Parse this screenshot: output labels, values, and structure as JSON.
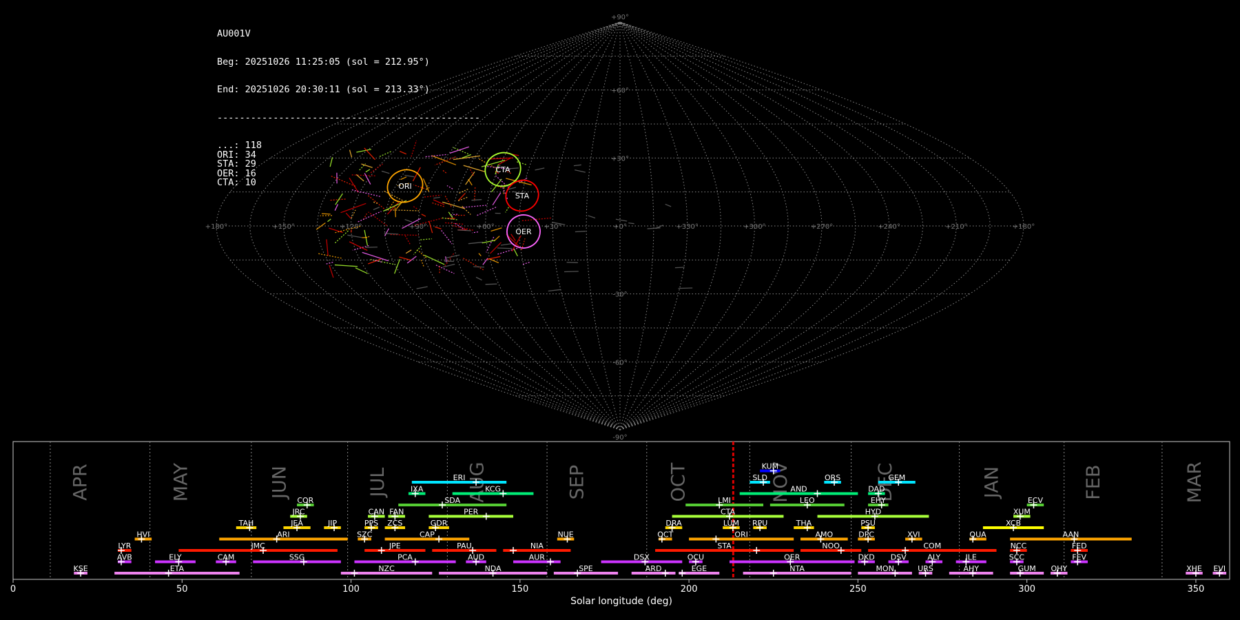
{
  "info": {
    "station": "AU001V",
    "begin": "Beg: 20251026 11:25:05 (sol = 212.95°)",
    "end": "End: 20251026 20:30:11 (sol = 213.33°)",
    "separator": "-----------------------------------------------",
    "counts": [
      {
        "label": "...",
        "value": "118"
      },
      {
        "label": "ORI",
        "value": "34"
      },
      {
        "label": "STA",
        "value": "29"
      },
      {
        "label": "OER",
        "value": "16"
      },
      {
        "label": "CTA",
        "value": "10"
      }
    ]
  },
  "sky_map": {
    "projection": "sinusoidal",
    "lat_labels": [
      "+90°",
      "+60°",
      "+30°",
      "-30°",
      "-60°",
      "-90°"
    ],
    "lon_labels": [
      "+180°",
      "+150°",
      "+120°",
      "+90°",
      "+60°",
      "+30°",
      "+0°",
      "+330°",
      "+300°",
      "+270°",
      "+240°",
      "+210°",
      "+180°"
    ],
    "radiants": [
      {
        "code": "CTA",
        "lon": 35,
        "lat": 25,
        "color": "#adff2f"
      },
      {
        "code": "ORI",
        "lon": 95,
        "lat": 0,
        "color": "#ffa500"
      },
      {
        "code": "STA",
        "lon": 45,
        "lat": 15,
        "color": "#ff0000"
      },
      {
        "code": "OER",
        "lon": 45,
        "lat": -10,
        "color": "#ff66ff"
      }
    ]
  },
  "chart_data": {
    "type": "timeline",
    "xlabel": "Solar longitude (deg)",
    "xlim": [
      0,
      360
    ],
    "xticks": [
      0,
      50,
      100,
      150,
      200,
      250,
      300,
      350
    ],
    "current_sol": 213.1,
    "months": [
      {
        "name": "APR",
        "start": 11
      },
      {
        "name": "MAY",
        "start": 40.5
      },
      {
        "name": "JUN",
        "start": 70.5
      },
      {
        "name": "JUL",
        "start": 99
      },
      {
        "name": "AUG",
        "start": 128.5
      },
      {
        "name": "SEP",
        "start": 158
      },
      {
        "name": "OCT",
        "start": 187.5
      },
      {
        "name": "NOV",
        "start": 218
      },
      {
        "name": "DEC",
        "start": 248
      },
      {
        "name": "JAN",
        "start": 280
      },
      {
        "name": "FEB",
        "start": 311
      },
      {
        "name": "MAR",
        "start": 340
      }
    ],
    "showers": [
      {
        "code": "KUM",
        "start": 221,
        "end": 227,
        "peak": 225,
        "row": 9,
        "color": "#0000ff"
      },
      {
        "code": "ERI",
        "start": 118,
        "end": 146,
        "peak": 137,
        "row": 8,
        "color": "#00e5ff"
      },
      {
        "code": "SLD",
        "start": 218,
        "end": 224,
        "peak": 222,
        "row": 8,
        "color": "#00e5ff"
      },
      {
        "code": "ORS",
        "start": 240,
        "end": 245,
        "peak": 243,
        "row": 8,
        "color": "#00e5ff"
      },
      {
        "code": "GEM",
        "start": 256,
        "end": 267,
        "peak": 262,
        "row": 8,
        "color": "#00e5ff"
      },
      {
        "code": "IXA",
        "start": 117,
        "end": 122,
        "peak": 119,
        "row": 7,
        "color": "#00ee77"
      },
      {
        "code": "KCG",
        "start": 130,
        "end": 154,
        "peak": 145,
        "row": 7,
        "color": "#00ee77"
      },
      {
        "code": "AND",
        "start": 215,
        "end": 250,
        "peak": 238,
        "row": 7,
        "color": "#00ee77"
      },
      {
        "code": "DAD",
        "start": 253,
        "end": 258,
        "peak": 256,
        "row": 7,
        "color": "#00ee77"
      },
      {
        "code": "COR",
        "start": 84,
        "end": 89,
        "peak": 87,
        "row": 6,
        "color": "#55cc33"
      },
      {
        "code": "SDA",
        "start": 114,
        "end": 146,
        "peak": 127,
        "row": 6,
        "color": "#55cc33"
      },
      {
        "code": "LMI",
        "start": 199,
        "end": 222,
        "peak": 209,
        "row": 6,
        "color": "#55cc33"
      },
      {
        "code": "LEO",
        "start": 224,
        "end": 246,
        "peak": 235,
        "row": 6,
        "color": "#55cc33"
      },
      {
        "code": "EHY",
        "start": 253,
        "end": 259,
        "peak": 257,
        "row": 6,
        "color": "#55cc33"
      },
      {
        "code": "ECV",
        "start": 300,
        "end": 305,
        "peak": 302,
        "row": 6,
        "color": "#55cc33"
      },
      {
        "code": "JRC",
        "start": 82,
        "end": 87,
        "peak": 85,
        "row": 5,
        "color": "#a8ff3a"
      },
      {
        "code": "CAN",
        "start": 105,
        "end": 110,
        "peak": 107,
        "row": 5,
        "color": "#a8ff3a"
      },
      {
        "code": "FAN",
        "start": 111,
        "end": 116,
        "peak": 113,
        "row": 5,
        "color": "#a8ff3a"
      },
      {
        "code": "PER",
        "start": 123,
        "end": 148,
        "peak": 140,
        "row": 5,
        "color": "#a8ff3a"
      },
      {
        "code": "CTA",
        "start": 195,
        "end": 228,
        "peak": 212,
        "row": 5,
        "color": "#a8ff3a"
      },
      {
        "code": "HYD",
        "start": 238,
        "end": 271,
        "peak": 255,
        "row": 5,
        "color": "#a8ff3a"
      },
      {
        "code": "XUM",
        "start": 296,
        "end": 301,
        "peak": 298,
        "row": 5,
        "color": "#a8ff3a"
      },
      {
        "code": "TAH",
        "start": 66,
        "end": 72,
        "peak": 70,
        "row": 4,
        "color": "#ffd700"
      },
      {
        "code": "JEA",
        "start": 80,
        "end": 88,
        "peak": 84,
        "row": 4,
        "color": "#ffd700"
      },
      {
        "code": "JIP",
        "start": 92,
        "end": 97,
        "peak": 95,
        "row": 4,
        "color": "#ffd700"
      },
      {
        "code": "PPS",
        "start": 104,
        "end": 108,
        "peak": 106,
        "row": 4,
        "color": "#ffd700"
      },
      {
        "code": "ZCS",
        "start": 110,
        "end": 116,
        "peak": 113,
        "row": 4,
        "color": "#ffd700"
      },
      {
        "code": "GDR",
        "start": 123,
        "end": 129,
        "peak": 125,
        "row": 4,
        "color": "#ffd700"
      },
      {
        "code": "DRA",
        "start": 193,
        "end": 198,
        "peak": 195,
        "row": 4,
        "color": "#ffd700"
      },
      {
        "code": "LUM",
        "start": 210,
        "end": 215,
        "peak": 213,
        "row": 4,
        "color": "#ffd700"
      },
      {
        "code": "RPU",
        "start": 219,
        "end": 223,
        "peak": 221,
        "row": 4,
        "color": "#ffd700"
      },
      {
        "code": "THA",
        "start": 231,
        "end": 237,
        "peak": 235,
        "row": 4,
        "color": "#ffd700"
      },
      {
        "code": "PSU",
        "start": 251,
        "end": 255,
        "peak": 253,
        "row": 4,
        "color": "#ffd700"
      },
      {
        "code": "XCB",
        "start": 287,
        "end": 305,
        "peak": 296,
        "row": 4,
        "color": "#ffff00"
      },
      {
        "code": "HVI",
        "start": 36,
        "end": 41,
        "peak": 38,
        "row": 3,
        "color": "#ffa500"
      },
      {
        "code": "ARI",
        "start": 61,
        "end": 99,
        "peak": 78,
        "row": 3,
        "color": "#ffa500"
      },
      {
        "code": "SZC",
        "start": 102,
        "end": 106,
        "peak": 104,
        "row": 3,
        "color": "#ffa500"
      },
      {
        "code": "CAP",
        "start": 110,
        "end": 135,
        "peak": 126,
        "row": 3,
        "color": "#ffa500"
      },
      {
        "code": "NUE",
        "start": 161,
        "end": 166,
        "peak": 164,
        "row": 3,
        "color": "#ffa500"
      },
      {
        "code": "OCT",
        "start": 191,
        "end": 195,
        "peak": 192,
        "row": 3,
        "color": "#ffa500"
      },
      {
        "code": "ORI",
        "start": 200,
        "end": 231,
        "peak": 208,
        "row": 3,
        "color": "#ffa500"
      },
      {
        "code": "AMO",
        "start": 233,
        "end": 247,
        "peak": 239,
        "row": 3,
        "color": "#ffa500"
      },
      {
        "code": "DPC",
        "start": 250,
        "end": 255,
        "peak": 253,
        "row": 3,
        "color": "#ffa500"
      },
      {
        "code": "XVI",
        "start": 264,
        "end": 269,
        "peak": 266,
        "row": 3,
        "color": "#ffa500"
      },
      {
        "code": "QUA",
        "start": 283,
        "end": 288,
        "peak": 284,
        "row": 3,
        "color": "#ffa500"
      },
      {
        "code": "AAN",
        "start": 295,
        "end": 331,
        "peak": 314,
        "row": 3,
        "color": "#ffa500"
      },
      {
        "code": "LYR",
        "start": 31,
        "end": 35,
        "peak": 32,
        "row": 2,
        "color": "#ff1a00"
      },
      {
        "code": "JMC",
        "start": 49,
        "end": 96,
        "peak": 74,
        "row": 2,
        "color": "#ff1a00"
      },
      {
        "code": "JPE",
        "start": 104,
        "end": 122,
        "peak": 109,
        "row": 2,
        "color": "#ff1a00"
      },
      {
        "code": "PAU",
        "start": 124,
        "end": 143,
        "peak": 136,
        "row": 2,
        "color": "#ff1a00"
      },
      {
        "code": "NIA",
        "start": 145,
        "end": 165,
        "peak": 148,
        "row": 2,
        "color": "#ff1a00"
      },
      {
        "code": "STA",
        "start": 190,
        "end": 231,
        "peak": 220,
        "row": 2,
        "color": "#ff1a00"
      },
      {
        "code": "NOO",
        "start": 233,
        "end": 251,
        "peak": 245,
        "row": 2,
        "color": "#ff1a00"
      },
      {
        "code": "COM",
        "start": 253,
        "end": 291,
        "peak": 264,
        "row": 2,
        "color": "#ff1a00"
      },
      {
        "code": "NCC",
        "start": 295,
        "end": 300,
        "peak": 297,
        "row": 2,
        "color": "#ff1a00"
      },
      {
        "code": "FED",
        "start": 313,
        "end": 318,
        "peak": 315,
        "row": 2,
        "color": "#ff1a00"
      },
      {
        "code": "AVB",
        "start": 31,
        "end": 35,
        "peak": 32,
        "row": 1,
        "color": "#cc33ff"
      },
      {
        "code": "ELY",
        "start": 42,
        "end": 54,
        "peak": 49,
        "row": 1,
        "color": "#cc33ff"
      },
      {
        "code": "CAM",
        "start": 60,
        "end": 66,
        "peak": 63,
        "row": 1,
        "color": "#cc33ff"
      },
      {
        "code": "SSG",
        "start": 71,
        "end": 97,
        "peak": 86,
        "row": 1,
        "color": "#cc33ff"
      },
      {
        "code": "PCA",
        "start": 101,
        "end": 131,
        "peak": 119,
        "row": 1,
        "color": "#cc33ff"
      },
      {
        "code": "AUD",
        "start": 134,
        "end": 140,
        "peak": 137,
        "row": 1,
        "color": "#cc33ff"
      },
      {
        "code": "AUR",
        "start": 148,
        "end": 162,
        "peak": 159,
        "row": 1,
        "color": "#cc33ff"
      },
      {
        "code": "DSX",
        "start": 174,
        "end": 198,
        "peak": 187,
        "row": 1,
        "color": "#cc33ff"
      },
      {
        "code": "OCU",
        "start": 200,
        "end": 204,
        "peak": 202,
        "row": 1,
        "color": "#cc33ff"
      },
      {
        "code": "OER",
        "start": 212,
        "end": 249,
        "peak": 230,
        "row": 1,
        "color": "#cc33ff"
      },
      {
        "code": "DKD",
        "start": 250,
        "end": 255,
        "peak": 252,
        "row": 1,
        "color": "#cc33ff"
      },
      {
        "code": "DSV",
        "start": 259,
        "end": 265,
        "peak": 262,
        "row": 1,
        "color": "#cc33ff"
      },
      {
        "code": "ALY",
        "start": 270,
        "end": 275,
        "peak": 272,
        "row": 1,
        "color": "#cc33ff"
      },
      {
        "code": "JLE",
        "start": 279,
        "end": 288,
        "peak": 282,
        "row": 1,
        "color": "#cc33ff"
      },
      {
        "code": "SCC",
        "start": 295,
        "end": 299,
        "peak": 297,
        "row": 1,
        "color": "#cc33ff"
      },
      {
        "code": "FEV",
        "start": 313,
        "end": 318,
        "peak": 315,
        "row": 1,
        "color": "#cc33ff"
      },
      {
        "code": "KSE",
        "start": 18,
        "end": 22,
        "peak": 20,
        "row": 0,
        "color": "#ee82ee"
      },
      {
        "code": "ETA",
        "start": 30,
        "end": 67,
        "peak": 46,
        "row": 0,
        "color": "#ee82ee"
      },
      {
        "code": "NZC",
        "start": 97,
        "end": 124,
        "peak": 101,
        "row": 0,
        "color": "#ee82ee"
      },
      {
        "code": "NDA",
        "start": 126,
        "end": 158,
        "peak": 142,
        "row": 0,
        "color": "#ee82ee"
      },
      {
        "code": "SPE",
        "start": 160,
        "end": 179,
        "peak": 167,
        "row": 0,
        "color": "#ee82ee"
      },
      {
        "code": "ARD",
        "start": 183,
        "end": 196,
        "peak": 193,
        "row": 0,
        "color": "#ee82ee"
      },
      {
        "code": "EGE",
        "start": 197,
        "end": 209,
        "peak": 198,
        "row": 0,
        "color": "#ee82ee"
      },
      {
        "code": "NTA",
        "start": 216,
        "end": 248,
        "peak": 225,
        "row": 0,
        "color": "#ee82ee"
      },
      {
        "code": "MON",
        "start": 250,
        "end": 266,
        "peak": 261,
        "row": 0,
        "color": "#ee82ee"
      },
      {
        "code": "URS",
        "start": 268,
        "end": 272,
        "peak": 270,
        "row": 0,
        "color": "#ee82ee"
      },
      {
        "code": "AHY",
        "start": 277,
        "end": 290,
        "peak": 284,
        "row": 0,
        "color": "#ee82ee"
      },
      {
        "code": "GUM",
        "start": 295,
        "end": 305,
        "peak": 298,
        "row": 0,
        "color": "#ee82ee"
      },
      {
        "code": "OHY",
        "start": 307,
        "end": 312,
        "peak": 309,
        "row": 0,
        "color": "#ee82ee"
      },
      {
        "code": "XHE",
        "start": 347,
        "end": 352,
        "peak": 350,
        "row": 0,
        "color": "#ee82ee"
      },
      {
        "code": "EVI",
        "start": 355,
        "end": 359,
        "peak": 357,
        "row": 0,
        "color": "#ee82ee"
      }
    ]
  }
}
